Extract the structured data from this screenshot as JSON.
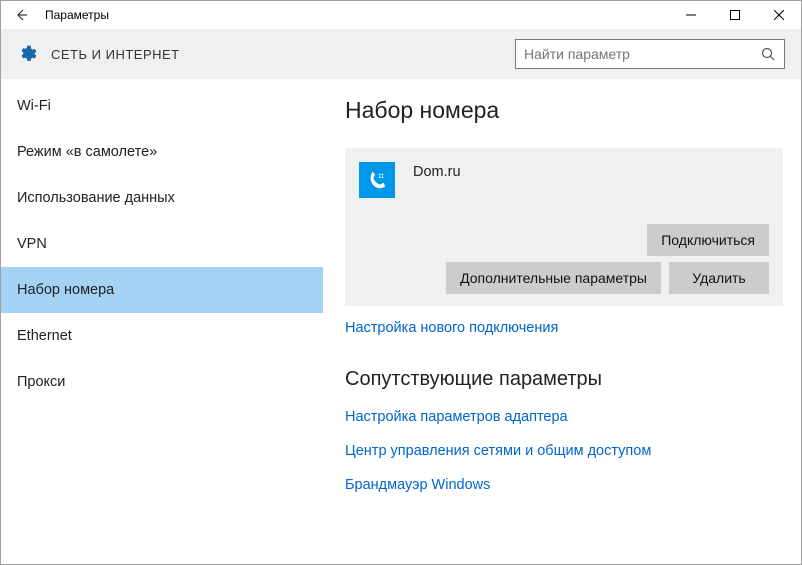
{
  "titlebar": {
    "title": "Параметры"
  },
  "header": {
    "category": "СЕТЬ И ИНТЕРНЕТ",
    "search_placeholder": "Найти параметр"
  },
  "sidebar": {
    "items": [
      {
        "label": "Wi-Fi"
      },
      {
        "label": "Режим «в самолете»"
      },
      {
        "label": "Использование данных"
      },
      {
        "label": "VPN"
      },
      {
        "label": "Набор номера",
        "selected": true
      },
      {
        "label": "Ethernet"
      },
      {
        "label": "Прокси"
      }
    ]
  },
  "main": {
    "page_title": "Набор номера",
    "connection_name": "Dom.ru",
    "btn_connect": "Подключиться",
    "btn_advanced": "Дополнительные параметры",
    "btn_delete": "Удалить",
    "link_new": "Настройка нового подключения",
    "related_title": "Сопутствующие параметры",
    "link_adapter": "Настройка параметров адаптера",
    "link_sharing": "Центр управления сетями и общим доступом",
    "link_firewall": "Брандмауэр Windows"
  }
}
